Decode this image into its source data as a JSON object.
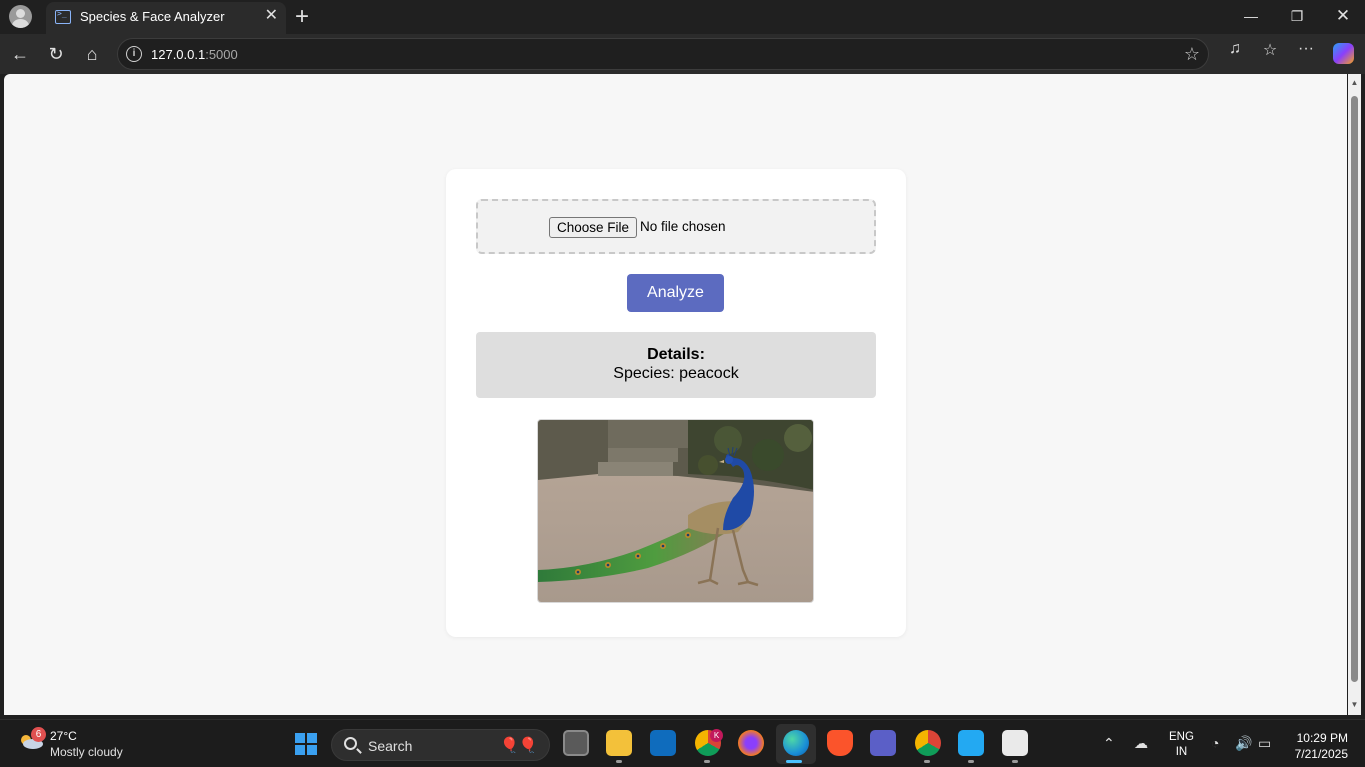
{
  "browser": {
    "tab_title": "Species & Face Analyzer",
    "url_host": "127.0.0.1",
    "url_port": ":5000"
  },
  "page": {
    "file_input": {
      "button_label": "Choose File",
      "status": "No file chosen"
    },
    "analyze_label": "Analyze",
    "details": {
      "label": "Details:",
      "species_text": "Species: peacock"
    },
    "image_subject": "peacock",
    "accent_color": "#5c6bc0"
  },
  "taskbar": {
    "weather": {
      "badge": "6",
      "temp": "27°C",
      "condition": "Mostly cloudy"
    },
    "search_placeholder": "Search",
    "language": {
      "line1": "ENG",
      "line2": "IN"
    },
    "clock": {
      "time": "10:29 PM",
      "date": "7/21/2025"
    },
    "outlook_badge": "K"
  }
}
